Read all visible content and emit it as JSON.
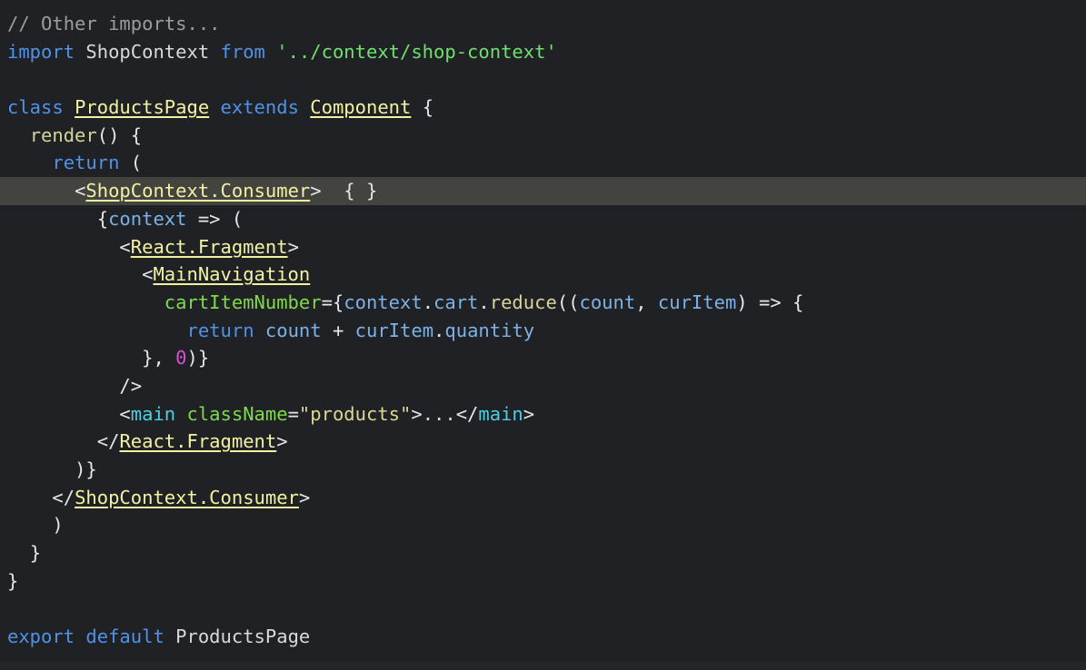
{
  "editor": {
    "language": "jsx",
    "background_color": "#202124",
    "highlight_line_color": "#434440",
    "highlighted_line_number": 7,
    "palette": {
      "comment": "#9a9ea3",
      "keyword": "#4f93e8",
      "string": "#6ee06e",
      "component": "#f2f2a3",
      "jsx_attribute": "#7fdb4a",
      "identifier": "#7bb2e8",
      "function": "#d6d69b",
      "number": "#d352d3",
      "punctuation": "#e6e6e6",
      "jsx_tag": "#4ccfe0",
      "attribute_string": "#d8d894",
      "plain_text": "#d7d9dc"
    }
  },
  "code": {
    "lines": [
      {
        "n": 1,
        "highlighted": false,
        "tokens": [
          {
            "c": "comment",
            "t": "// Other imports..."
          }
        ]
      },
      {
        "n": 2,
        "highlighted": false,
        "tokens": [
          {
            "c": "keyword",
            "t": "import"
          },
          {
            "c": "plain",
            "t": " "
          },
          {
            "c": "plain",
            "t": "ShopContext"
          },
          {
            "c": "plain",
            "t": " "
          },
          {
            "c": "keyword",
            "t": "from"
          },
          {
            "c": "plain",
            "t": " "
          },
          {
            "c": "string",
            "t": "'../context/shop-context'"
          }
        ]
      },
      {
        "n": 3,
        "highlighted": false,
        "tokens": [
          {
            "c": "plain",
            "t": ""
          }
        ]
      },
      {
        "n": 4,
        "highlighted": false,
        "tokens": [
          {
            "c": "keyword",
            "t": "class"
          },
          {
            "c": "plain",
            "t": " "
          },
          {
            "c": "comp",
            "t": "ProductsPage"
          },
          {
            "c": "plain",
            "t": " "
          },
          {
            "c": "keyword",
            "t": "extends"
          },
          {
            "c": "plain",
            "t": " "
          },
          {
            "c": "comp",
            "t": "Component"
          },
          {
            "c": "punct",
            "t": " {"
          }
        ]
      },
      {
        "n": 5,
        "highlighted": false,
        "tokens": [
          {
            "c": "plain",
            "t": "  "
          },
          {
            "c": "func",
            "t": "render"
          },
          {
            "c": "punct",
            "t": "() {"
          }
        ]
      },
      {
        "n": 6,
        "highlighted": false,
        "tokens": [
          {
            "c": "plain",
            "t": "    "
          },
          {
            "c": "keyword",
            "t": "return"
          },
          {
            "c": "punct",
            "t": " ("
          }
        ]
      },
      {
        "n": 7,
        "highlighted": true,
        "tokens": [
          {
            "c": "plain",
            "t": "      "
          },
          {
            "c": "punct",
            "t": "<"
          },
          {
            "c": "comp",
            "t": "ShopContext.Consumer"
          },
          {
            "c": "punct",
            "t": ">"
          },
          {
            "c": "plain",
            "t": "  "
          },
          {
            "c": "punct",
            "t": "{ }"
          }
        ]
      },
      {
        "n": 8,
        "highlighted": false,
        "tokens": [
          {
            "c": "plain",
            "t": "        "
          },
          {
            "c": "punct",
            "t": "{"
          },
          {
            "c": "ident",
            "t": "context"
          },
          {
            "c": "punct",
            "t": " => ("
          }
        ]
      },
      {
        "n": 9,
        "highlighted": false,
        "tokens": [
          {
            "c": "plain",
            "t": "          "
          },
          {
            "c": "punct",
            "t": "<"
          },
          {
            "c": "comp",
            "t": "React.Fragment"
          },
          {
            "c": "punct",
            "t": ">"
          }
        ]
      },
      {
        "n": 10,
        "highlighted": false,
        "tokens": [
          {
            "c": "plain",
            "t": "            "
          },
          {
            "c": "punct",
            "t": "<"
          },
          {
            "c": "comp",
            "t": "MainNavigation"
          }
        ]
      },
      {
        "n": 11,
        "highlighted": false,
        "tokens": [
          {
            "c": "plain",
            "t": "              "
          },
          {
            "c": "attr",
            "t": "cartItemNumber"
          },
          {
            "c": "punct",
            "t": "={"
          },
          {
            "c": "ident",
            "t": "context"
          },
          {
            "c": "punct",
            "t": "."
          },
          {
            "c": "ident",
            "t": "cart"
          },
          {
            "c": "punct",
            "t": "."
          },
          {
            "c": "func",
            "t": "reduce"
          },
          {
            "c": "punct",
            "t": "(("
          },
          {
            "c": "ident",
            "t": "count"
          },
          {
            "c": "punct",
            "t": ", "
          },
          {
            "c": "ident",
            "t": "curItem"
          },
          {
            "c": "punct",
            "t": ") => {"
          }
        ]
      },
      {
        "n": 12,
        "highlighted": false,
        "tokens": [
          {
            "c": "plain",
            "t": "                "
          },
          {
            "c": "keyword",
            "t": "return"
          },
          {
            "c": "plain",
            "t": " "
          },
          {
            "c": "ident",
            "t": "count"
          },
          {
            "c": "punct",
            "t": " + "
          },
          {
            "c": "ident",
            "t": "curItem"
          },
          {
            "c": "punct",
            "t": "."
          },
          {
            "c": "ident",
            "t": "quantity"
          }
        ]
      },
      {
        "n": 13,
        "highlighted": false,
        "tokens": [
          {
            "c": "plain",
            "t": "            "
          },
          {
            "c": "punct",
            "t": "}, "
          },
          {
            "c": "num",
            "t": "0"
          },
          {
            "c": "punct",
            "t": ")}"
          }
        ]
      },
      {
        "n": 14,
        "highlighted": false,
        "tokens": [
          {
            "c": "plain",
            "t": "          "
          },
          {
            "c": "punct",
            "t": "/>"
          }
        ]
      },
      {
        "n": 15,
        "highlighted": false,
        "tokens": [
          {
            "c": "plain",
            "t": "          "
          },
          {
            "c": "punct",
            "t": "<"
          },
          {
            "c": "tag",
            "t": "main"
          },
          {
            "c": "plain",
            "t": " "
          },
          {
            "c": "attr",
            "t": "className"
          },
          {
            "c": "punct",
            "t": "="
          },
          {
            "c": "attrstr",
            "t": "\"products\""
          },
          {
            "c": "punct",
            "t": ">"
          },
          {
            "c": "plain",
            "t": "..."
          },
          {
            "c": "punct",
            "t": "</"
          },
          {
            "c": "tag",
            "t": "main"
          },
          {
            "c": "punct",
            "t": ">"
          }
        ]
      },
      {
        "n": 16,
        "highlighted": false,
        "tokens": [
          {
            "c": "plain",
            "t": "        "
          },
          {
            "c": "punct",
            "t": "</"
          },
          {
            "c": "comp",
            "t": "React.Fragment"
          },
          {
            "c": "punct",
            "t": ">"
          }
        ]
      },
      {
        "n": 17,
        "highlighted": false,
        "tokens": [
          {
            "c": "plain",
            "t": "      "
          },
          {
            "c": "punct",
            "t": ")}"
          }
        ]
      },
      {
        "n": 18,
        "highlighted": false,
        "tokens": [
          {
            "c": "plain",
            "t": "    "
          },
          {
            "c": "punct",
            "t": "</"
          },
          {
            "c": "comp",
            "t": "ShopContext.Consumer"
          },
          {
            "c": "punct",
            "t": ">"
          }
        ]
      },
      {
        "n": 19,
        "highlighted": false,
        "tokens": [
          {
            "c": "plain",
            "t": "    "
          },
          {
            "c": "punct",
            "t": ")"
          }
        ]
      },
      {
        "n": 20,
        "highlighted": false,
        "tokens": [
          {
            "c": "plain",
            "t": "  "
          },
          {
            "c": "punct",
            "t": "}"
          }
        ]
      },
      {
        "n": 21,
        "highlighted": false,
        "tokens": [
          {
            "c": "punct",
            "t": "}"
          }
        ]
      },
      {
        "n": 22,
        "highlighted": false,
        "tokens": [
          {
            "c": "plain",
            "t": ""
          }
        ]
      },
      {
        "n": 23,
        "highlighted": false,
        "tokens": [
          {
            "c": "keyword",
            "t": "export"
          },
          {
            "c": "plain",
            "t": " "
          },
          {
            "c": "keyword",
            "t": "default"
          },
          {
            "c": "plain",
            "t": " "
          },
          {
            "c": "plain",
            "t": "ProductsPage"
          }
        ]
      }
    ]
  }
}
